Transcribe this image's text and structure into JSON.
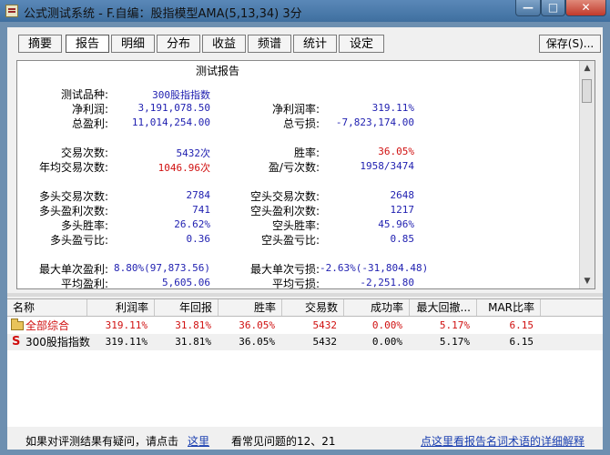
{
  "window": {
    "title": "公式测试系统 - F.自编：股指模型AMA(5,13,34) 3分"
  },
  "tabs": [
    "摘要",
    "报告",
    "明细",
    "分布",
    "收益",
    "频谱",
    "统计",
    "设定"
  ],
  "active_tab": "报告",
  "save_button": "保存(S)...",
  "report": {
    "title": "测试报告",
    "left": [
      {
        "label": "测试品种:",
        "value": "300股指指数",
        "color": "blue"
      },
      {
        "label": "净利润:",
        "value": "3,191,078.50",
        "color": "blue"
      },
      {
        "label": "总盈利:",
        "value": "11,014,254.00",
        "color": "blue"
      },
      {
        "label": "交易次数:",
        "value": "5432次",
        "color": "blue"
      },
      {
        "label": "年均交易次数:",
        "value": "1046.96次",
        "color": "red"
      },
      {
        "label": "多头交易次数:",
        "value": "2784",
        "color": "blue"
      },
      {
        "label": "多头盈利次数:",
        "value": "741",
        "color": "blue"
      },
      {
        "label": "多头胜率:",
        "value": "26.62%",
        "color": "blue"
      },
      {
        "label": "多头盈亏比:",
        "value": "0.36",
        "color": "blue"
      },
      {
        "label": "最大单次盈利:",
        "value": "8.80%(97,873.56)",
        "color": "blue"
      },
      {
        "label": "平均盈利:",
        "value": "5,605.06",
        "color": "blue"
      }
    ],
    "right": [
      {
        "label": "净利润率:",
        "value": "319.11%",
        "color": "blue"
      },
      {
        "label": "总亏损:",
        "value": "-7,823,174.00",
        "color": "blue"
      },
      {
        "label": "胜率:",
        "value": "36.05%",
        "color": "red"
      },
      {
        "label": "盈/亏次数:",
        "value": "1958/3474",
        "color": "blue"
      },
      {
        "label": "空头交易次数:",
        "value": "2648",
        "color": "blue"
      },
      {
        "label": "空头盈利次数:",
        "value": "1217",
        "color": "blue"
      },
      {
        "label": "空头胜率:",
        "value": "45.96%",
        "color": "blue"
      },
      {
        "label": "空头盈亏比:",
        "value": "0.85",
        "color": "blue"
      },
      {
        "label": "最大单次亏损:",
        "value": "-2.63%(-31,804.48)",
        "color": "blue"
      },
      {
        "label": "平均亏损:",
        "value": "-2,251.80",
        "color": "blue"
      }
    ]
  },
  "table": {
    "headers": [
      "名称",
      "利润率",
      "年回报",
      "胜率",
      "交易数",
      "成功率",
      "最大回撤...",
      "MAR比率"
    ],
    "rows": [
      {
        "icon": "folder-icon",
        "name": "全部综合",
        "values": [
          "319.11%",
          "31.81%",
          "36.05%",
          "5432",
          "0.00%",
          "5.17%",
          "6.15"
        ],
        "color": "red"
      },
      {
        "icon": "s-icon",
        "name": "300股指指数",
        "values": [
          "319.11%",
          "31.81%",
          "36.05%",
          "5432",
          "0.00%",
          "5.17%",
          "6.15"
        ],
        "color": "black"
      }
    ]
  },
  "footer": {
    "text1": "如果对评测结果有疑问，请点击",
    "link1": "这里",
    "text2": "看常见问题的12、21",
    "link2": "点这里看报告名词术语的详细解释"
  }
}
